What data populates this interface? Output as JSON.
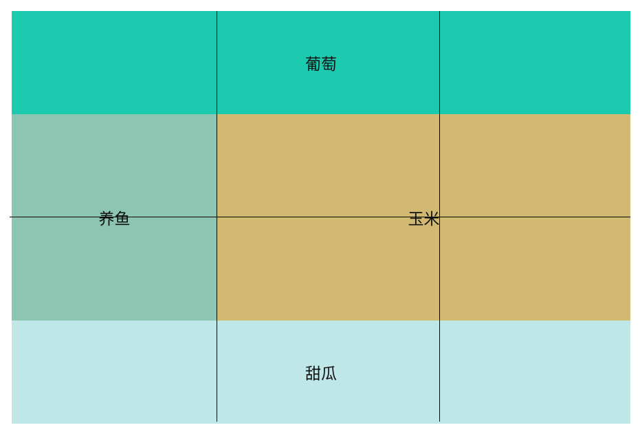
{
  "regions": [
    {
      "id": "grapes",
      "label": "葡萄",
      "color": "#1ccbaf"
    },
    {
      "id": "fish-farming",
      "label": "养鱼",
      "color": "#8cc6b3"
    },
    {
      "id": "corn",
      "label": "玉米",
      "color": "#d1b972"
    },
    {
      "id": "melon",
      "label": "甜瓜",
      "color": "#c0e7e8"
    }
  ]
}
